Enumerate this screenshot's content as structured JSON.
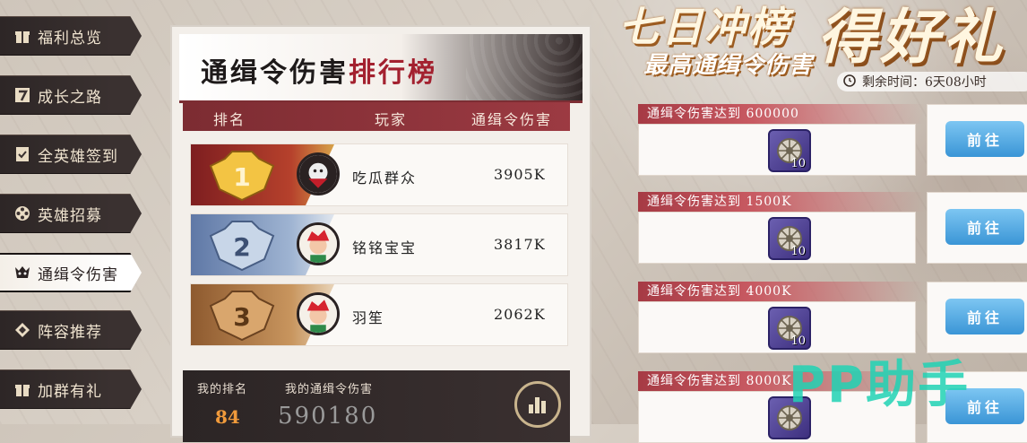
{
  "sidebar": {
    "items": [
      {
        "label": "福利总览",
        "icon": "gift-icon"
      },
      {
        "label": "成长之路",
        "icon": "seven-icon"
      },
      {
        "label": "全英雄签到",
        "icon": "checkin-icon"
      },
      {
        "label": "英雄招募",
        "icon": "film-reel-icon"
      },
      {
        "label": "通缉令伤害",
        "icon": "demon-mask-icon",
        "active": true
      },
      {
        "label": "阵容推荐",
        "icon": "lineup-icon"
      },
      {
        "label": "加群有礼",
        "icon": "gift-box-icon"
      }
    ]
  },
  "leaderboard": {
    "title_part1": "通缉令伤害",
    "title_part2": "排行榜",
    "col_rank": "排名",
    "col_player": "玩家",
    "col_damage": "通缉令伤害",
    "rows": [
      {
        "rank": "1",
        "name": "吃瓜群众",
        "damage": "3905K"
      },
      {
        "rank": "2",
        "name": "铭铭宝宝",
        "damage": "3817K"
      },
      {
        "rank": "3",
        "name": "羽笙",
        "damage": "2062K"
      }
    ],
    "my_rank_label": "我的排名",
    "my_damage_label": "我的通缉令伤害",
    "my_rank": "84",
    "my_damage": "590180"
  },
  "banner": {
    "title": "七日冲榜",
    "big": "得好礼",
    "subtitle": "最高通缉令伤害",
    "remain_label": "剩余时间：",
    "remain_value": "6天08小时"
  },
  "tasks": [
    {
      "label": "通缉令伤害达到 600000",
      "reward_count": "10",
      "button": "前往"
    },
    {
      "label": "通缉令伤害达到 1500K",
      "reward_count": "10",
      "button": "前往"
    },
    {
      "label": "通缉令伤害达到 4000K",
      "reward_count": "10",
      "button": "前往"
    },
    {
      "label": "通缉令伤害达到 8000K",
      "reward_count": "",
      "button": "前往"
    }
  ],
  "watermark": "PP助手",
  "colors": {
    "accent_red": "#a3212f",
    "button_blue": "#3a95d6",
    "rank_gold": "#d59a22",
    "rank_silver": "#8fa6c7",
    "rank_bronze": "#b77a3f"
  }
}
